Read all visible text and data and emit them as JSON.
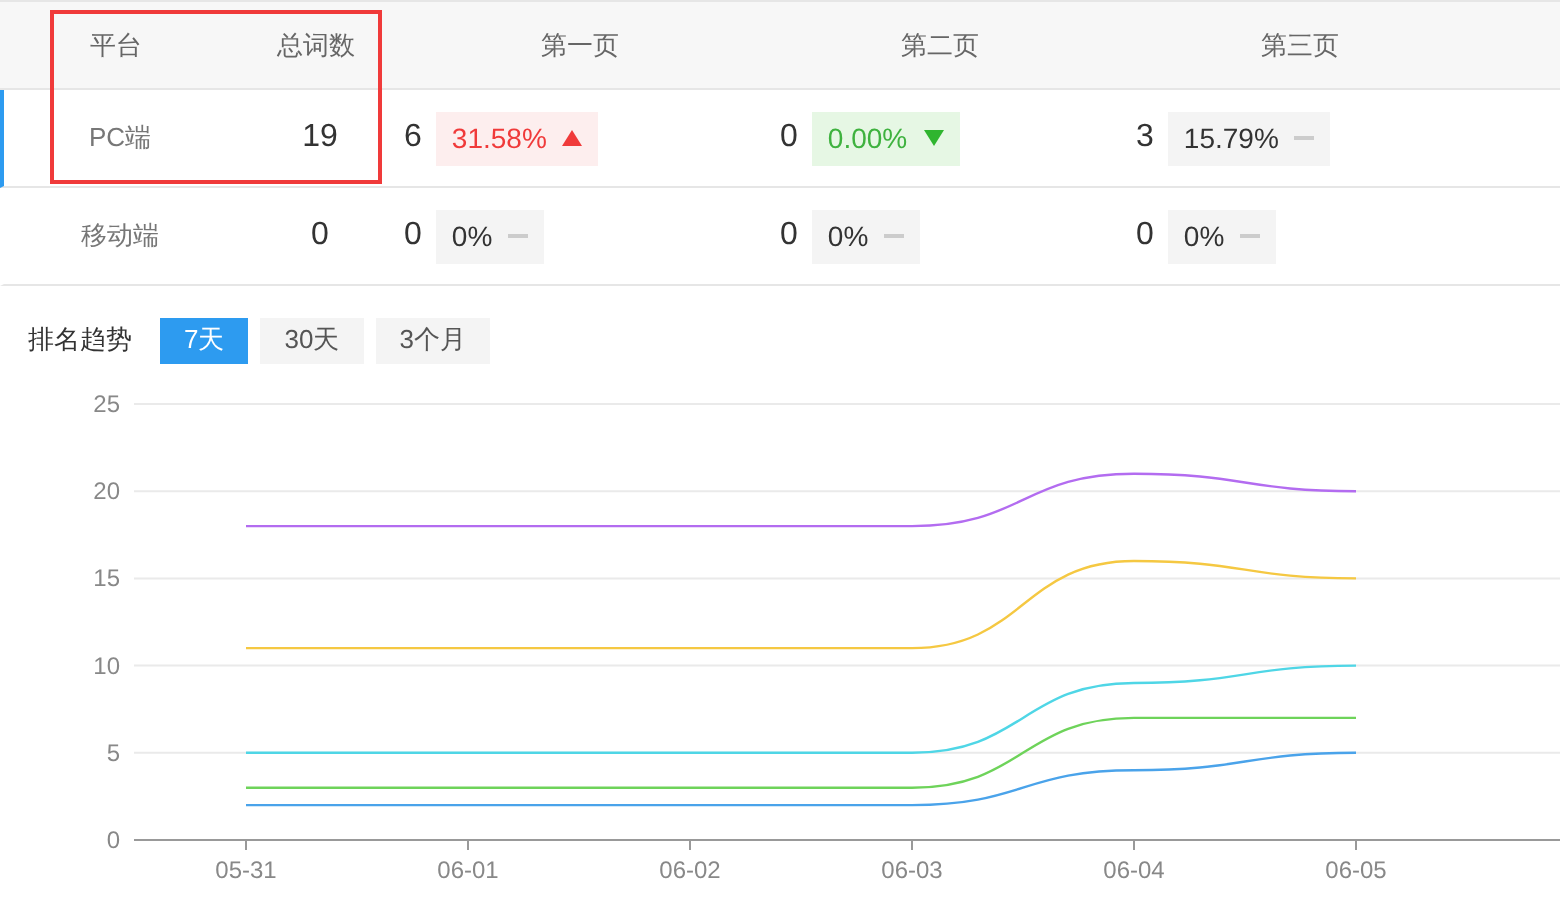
{
  "table": {
    "columns": [
      "平台",
      "总词数",
      "第一页",
      "第二页",
      "第三页"
    ],
    "rows": [
      {
        "platform": "PC端",
        "total": "19",
        "selected": true,
        "highlighted": true,
        "pages": [
          {
            "count": "6",
            "percent": "31.58%",
            "kind": "up"
          },
          {
            "count": "0",
            "percent": "0.00%",
            "kind": "down"
          },
          {
            "count": "3",
            "percent": "15.79%",
            "kind": "flat"
          }
        ]
      },
      {
        "platform": "移动端",
        "total": "0",
        "selected": false,
        "highlighted": false,
        "pages": [
          {
            "count": "0",
            "percent": "0%",
            "kind": "flat"
          },
          {
            "count": "0",
            "percent": "0%",
            "kind": "flat"
          },
          {
            "count": "0",
            "percent": "0%",
            "kind": "flat"
          }
        ]
      }
    ]
  },
  "trend": {
    "label": "排名趋势",
    "ranges": [
      {
        "label": "7天",
        "selected": true
      },
      {
        "label": "30天",
        "selected": false
      },
      {
        "label": "3个月",
        "selected": false
      }
    ],
    "chart_data": {
      "type": "line",
      "categories": [
        "05-31",
        "06-01",
        "06-02",
        "06-03",
        "06-04",
        "06-05"
      ],
      "ylim": [
        0,
        25
      ],
      "grid": true,
      "yticks": [
        0,
        5,
        10,
        15,
        20,
        25
      ],
      "series": [
        {
          "color": "#b36cf0",
          "values": [
            18,
            18,
            18,
            18,
            21,
            20
          ]
        },
        {
          "color": "#f5c842",
          "values": [
            11,
            11,
            11,
            11,
            16,
            15
          ]
        },
        {
          "color": "#4fd6e6",
          "values": [
            5,
            5,
            5,
            5,
            9,
            10
          ]
        },
        {
          "color": "#6ed35a",
          "values": [
            3,
            3,
            3,
            3,
            7,
            7
          ]
        },
        {
          "color": "#4aa3ea",
          "values": [
            2,
            2,
            2,
            2,
            4,
            5
          ]
        }
      ]
    }
  }
}
